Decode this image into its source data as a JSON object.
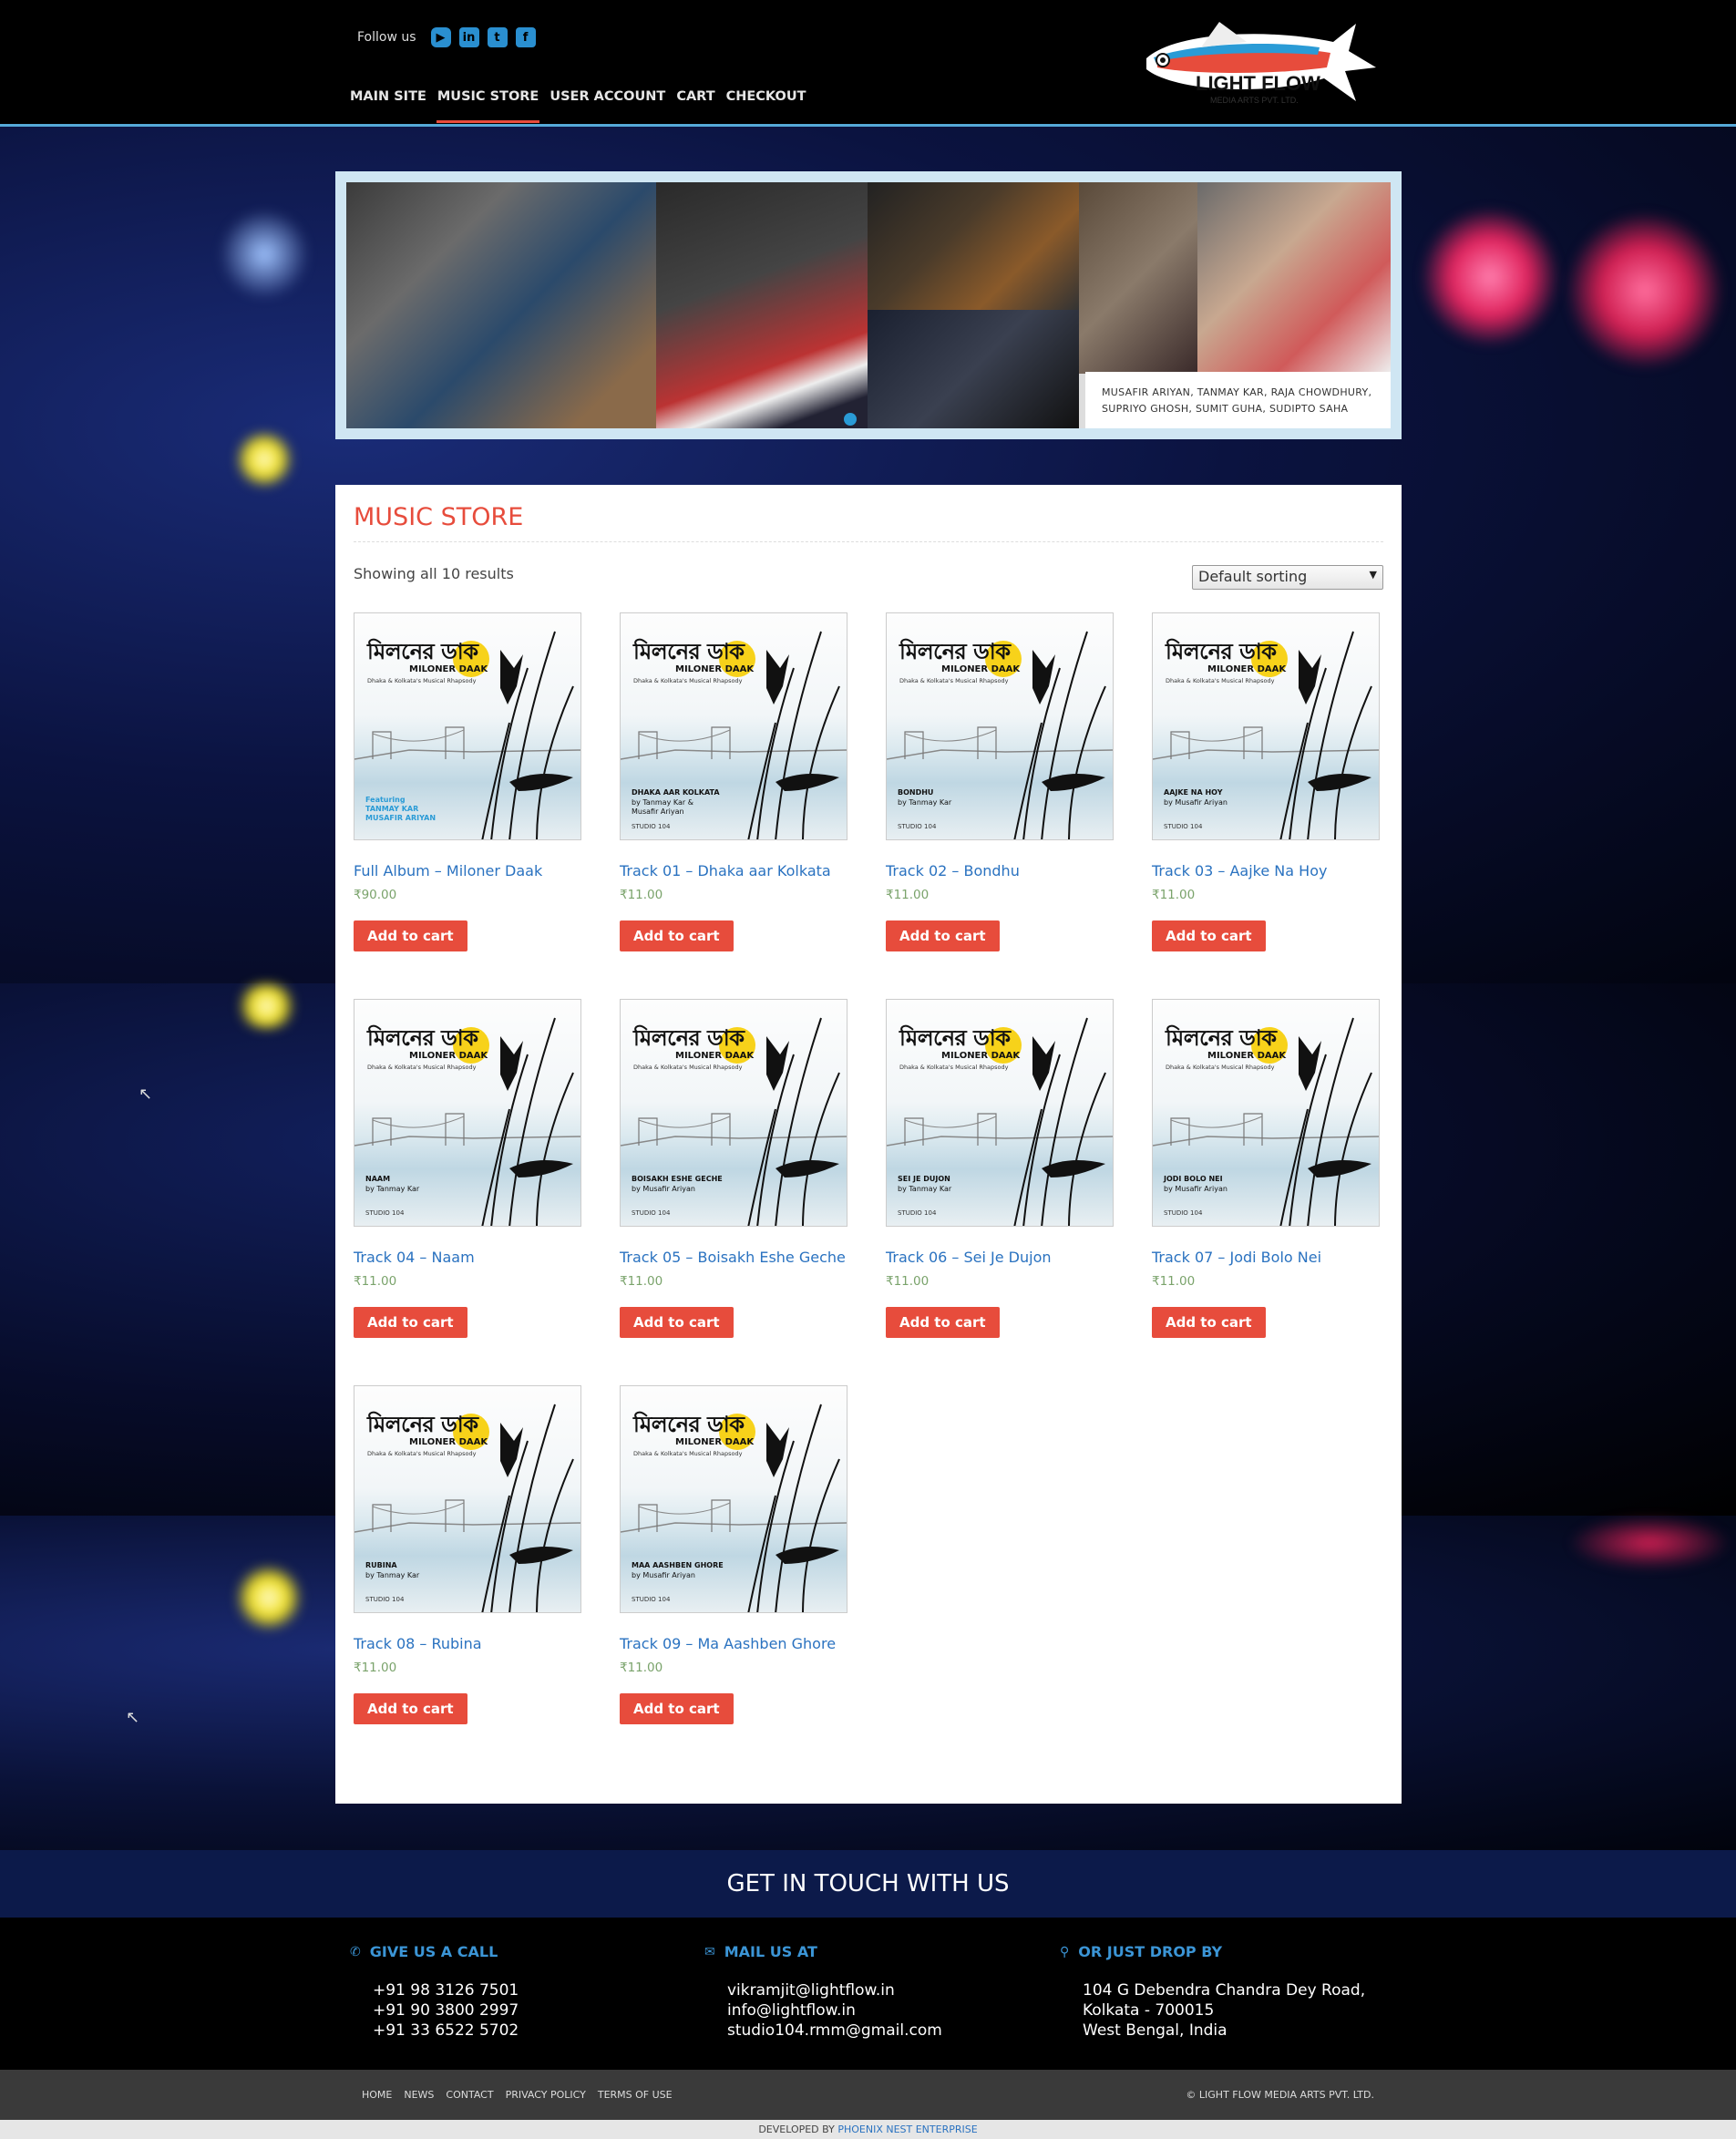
{
  "header": {
    "follow_label": "Follow us",
    "social": [
      {
        "name": "youtube",
        "glyph": "▶"
      },
      {
        "name": "linkedin",
        "glyph": "in"
      },
      {
        "name": "twitter",
        "glyph": "t"
      },
      {
        "name": "facebook",
        "glyph": "f"
      }
    ],
    "nav": [
      "MAIN SITE",
      "MUSIC STORE",
      "USER ACCOUNT",
      "CART",
      "CHECKOUT"
    ],
    "active_nav": "MUSIC STORE",
    "logo": {
      "title": "LIGHT FLOW",
      "subtitle": "MEDIA ARTS PVT. LTD."
    }
  },
  "slider": {
    "caption_line1": "MUSAFIR ARIYAN, TANMAY KAR, RAJA CHOWDHURY,",
    "caption_line2": "SUPRIYO GHOSH, SUMIT GUHA, SUDIPTO SAHA"
  },
  "store": {
    "title": "MUSIC STORE",
    "results_text": "Showing all 10 results",
    "sort_value": "Default sorting",
    "cover_bengali": "মিলনের ডাক",
    "cover_english": "MILONER DAAK",
    "cover_sub": "Dhaka & Kolkata's Musical Rhapsody",
    "cover_studio": "STUDIO 104",
    "button_label": "Add to cart",
    "products": [
      {
        "name": "Full Album – Miloner Daak",
        "price": "₹90.00",
        "cover_track": "Featuring",
        "cover_artist": "TANMAY KAR\nMUSAFIR ARIYAN",
        "featured": true
      },
      {
        "name": "Track 01 – Dhaka aar Kolkata",
        "price": "₹11.00",
        "cover_track": "DHAKA AAR KOLKATA",
        "cover_artist": "by Tanmay Kar &\nMusafir Ariyan"
      },
      {
        "name": "Track 02 – Bondhu",
        "price": "₹11.00",
        "cover_track": "BONDHU",
        "cover_artist": "by Tanmay Kar"
      },
      {
        "name": "Track 03 – Aajke Na Hoy",
        "price": "₹11.00",
        "cover_track": "AAJKE NA HOY",
        "cover_artist": "by Musafir Ariyan"
      },
      {
        "name": "Track 04 – Naam",
        "price": "₹11.00",
        "cover_track": "NAAM",
        "cover_artist": "by Tanmay Kar"
      },
      {
        "name": "Track 05 – Boisakh Eshe Geche",
        "price": "₹11.00",
        "cover_track": "BOISAKH ESHE GECHE",
        "cover_artist": "by Musafir Ariyan"
      },
      {
        "name": "Track 06 – Sei Je Dujon",
        "price": "₹11.00",
        "cover_track": "SEI JE DUJON",
        "cover_artist": "by Tanmay Kar"
      },
      {
        "name": "Track 07 – Jodi Bolo Nei",
        "price": "₹11.00",
        "cover_track": "JODI BOLO NEI",
        "cover_artist": "by Musafir Ariyan"
      },
      {
        "name": "Track 08 – Rubina",
        "price": "₹11.00",
        "cover_track": "RUBINA",
        "cover_artist": "by Tanmay Kar"
      },
      {
        "name": "Track 09 – Ma Aashben Ghore",
        "price": "₹11.00",
        "cover_track": "MAA AASHBEN GHORE",
        "cover_artist": "by Musafir Ariyan"
      }
    ]
  },
  "contact": {
    "title": "GET IN TOUCH WITH US",
    "call": {
      "heading": "GIVE US A CALL",
      "lines": [
        "+91 98 3126 7501",
        "+91 90 3800 2997",
        "+91 33 6522 5702"
      ]
    },
    "mail": {
      "heading": "MAIL US AT",
      "lines": [
        "vikramjit@lightflow.in",
        "info@lightflow.in",
        "studio104.rmm@gmail.com"
      ]
    },
    "visit": {
      "heading": "OR JUST DROP BY",
      "lines": [
        "104 G Debendra Chandra Dey Road,",
        "Kolkata - 700015",
        "West Bengal, India"
      ]
    }
  },
  "footer": {
    "links": [
      "HOME",
      "NEWS",
      "CONTACT",
      "PRIVACY POLICY",
      "TERMS OF USE"
    ],
    "copyright": "© LIGHT FLOW MEDIA ARTS PVT. LTD.",
    "developed_by": "DEVELOPED BY",
    "developer": "PHOENIX NEST ENTERPRISE"
  },
  "colors": {
    "accent": "#e74c3c",
    "link": "#2a72c0",
    "nav_line": "#55a9d8",
    "price": "#7aa36b"
  }
}
